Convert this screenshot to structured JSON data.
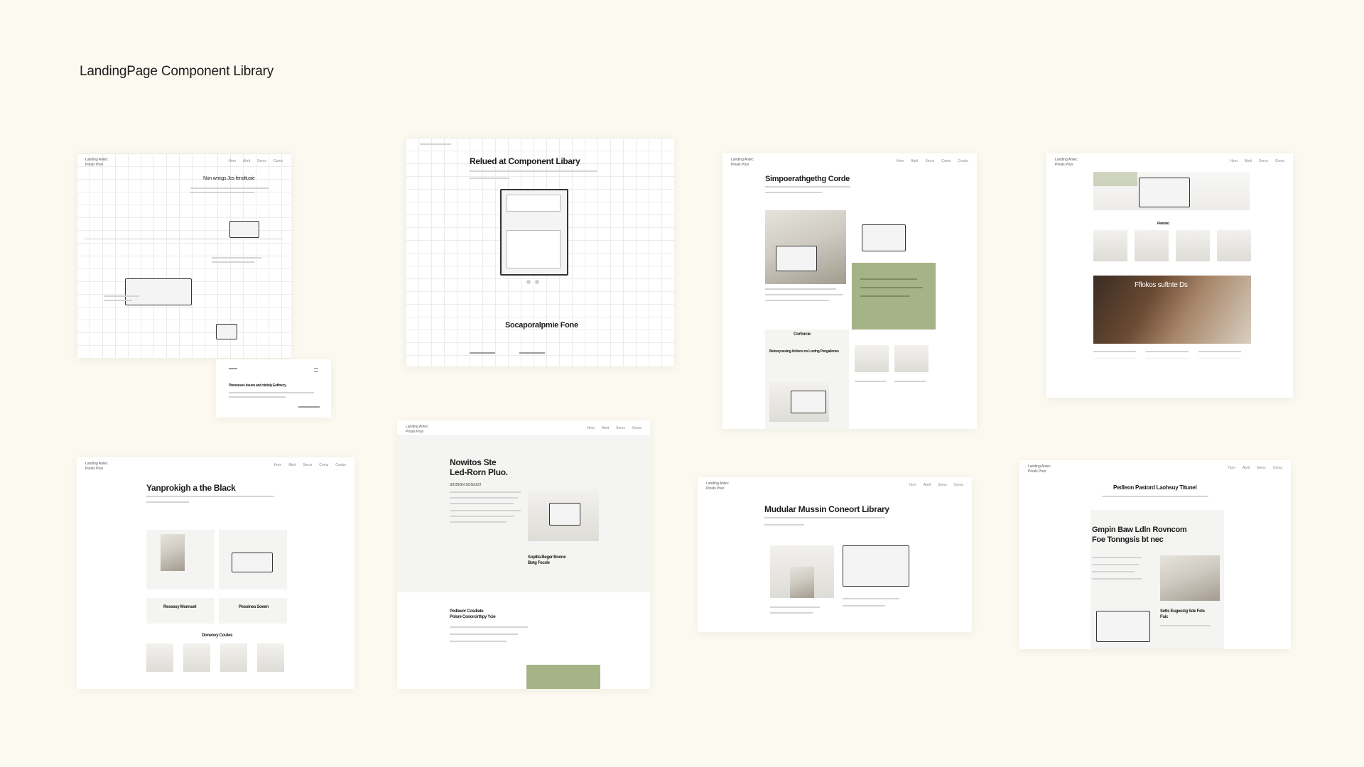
{
  "page": {
    "title": "LandingPage Component Library"
  },
  "cards": {
    "c1": {
      "title": "Non wnngs Jos fenoltusie"
    },
    "c1b": {
      "title": "Prenosses bsuen and ninioly Eeftnecy"
    },
    "c2": {
      "title": "Relued at Component Libary",
      "subtitle": "Socaporalpmie Fone"
    },
    "c3": {
      "title": "Simpoerathgethg Corde",
      "section": "Corforcie",
      "feature_title": "Bekwrynesing Actions no Lordng Pengaliones"
    },
    "c4": {
      "section": "Flwnsto",
      "overlay": "Fflokos suftnte Ds"
    },
    "c5": {
      "title": "Yanprokigh a the Black",
      "card_a": "Recessy Monnuel",
      "card_b": "Pesoinea Soeen",
      "section": "Doneovy Coutes"
    },
    "c6": {
      "title_l1": "Nowitos Ste",
      "title_l2": "Led-Rorn Pluo.",
      "label": "SICDIGN SOGIUST",
      "subhead_l1": "Soplita Beger Boone",
      "subhead_l2": "Botg Fecsle",
      "section_l1": "Pedlavor Cosdiate",
      "section_l2": "Polsre Conorcirthpy Ycie"
    },
    "c7": {
      "title": "Mudular Mussin Coneort Library"
    },
    "c8": {
      "title": "Pedleon Pastord Laohsuy Tltunel",
      "subhead_l1": "Gmpin Baw Ldln Rovncom",
      "subhead_l2": "Foe Tonngsis bt nec",
      "caption_l1": "Setts Eugeozig Sde Fets",
      "caption_l2": "Fuic"
    }
  },
  "nav_items": [
    "Hom",
    "Abrit",
    "Servs",
    "Coms",
    "Conbo"
  ],
  "brand": {
    "line1": "Landing Antec",
    "line2": "Pinals Ptuo"
  },
  "colors": {
    "background": "#fcfaf0",
    "accent_green": "#a5b486"
  }
}
